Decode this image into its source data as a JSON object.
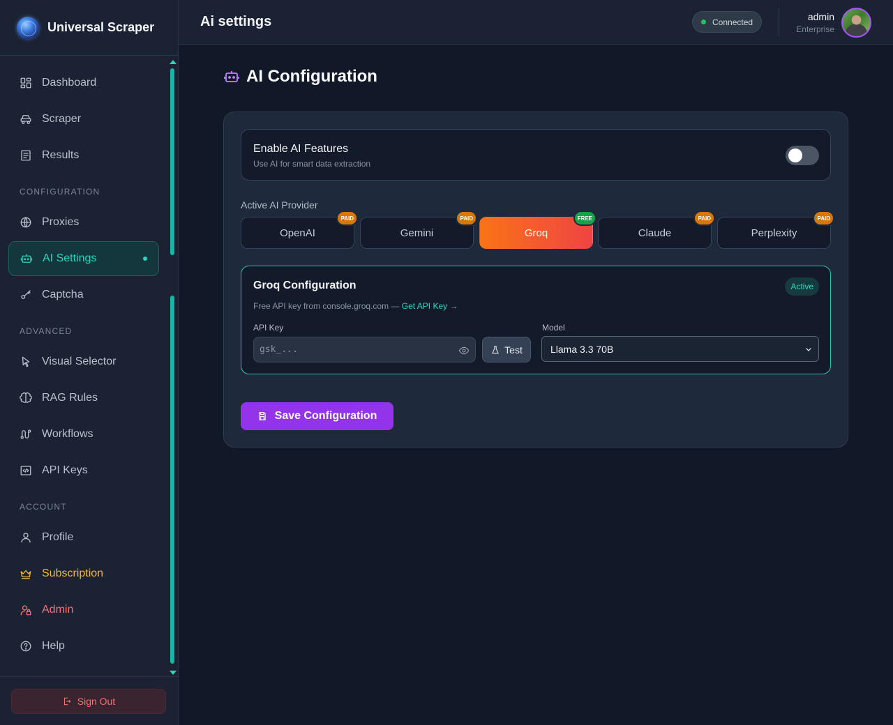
{
  "app": {
    "name": "Universal Scraper"
  },
  "sidebar": {
    "items": [
      {
        "label": "Dashboard",
        "icon": "dashboard-icon"
      },
      {
        "label": "Scraper",
        "icon": "scraper-icon"
      },
      {
        "label": "Results",
        "icon": "results-icon"
      }
    ],
    "section_configuration": "CONFIGURATION",
    "config_items": [
      {
        "label": "Proxies",
        "icon": "globe-icon"
      },
      {
        "label": "AI Settings",
        "icon": "robot-icon",
        "active": true
      },
      {
        "label": "Captcha",
        "icon": "key-icon"
      }
    ],
    "section_advanced": "ADVANCED",
    "advanced_items": [
      {
        "label": "Visual Selector",
        "icon": "cursor-icon"
      },
      {
        "label": "RAG Rules",
        "icon": "brain-icon"
      },
      {
        "label": "Workflows",
        "icon": "workflow-icon"
      },
      {
        "label": "API Keys",
        "icon": "code-icon"
      }
    ],
    "section_account": "ACCOUNT",
    "account_items": [
      {
        "label": "Profile",
        "icon": "user-icon"
      },
      {
        "label": "Subscription",
        "icon": "crown-icon",
        "color": "#f5b836"
      },
      {
        "label": "Admin",
        "icon": "user-lock-icon",
        "color": "#f87171"
      },
      {
        "label": "Help",
        "icon": "help-icon"
      }
    ],
    "sign_out": "Sign Out"
  },
  "header": {
    "title": "Ai settings",
    "status": "Connected",
    "user_name": "admin",
    "user_plan": "Enterprise"
  },
  "main": {
    "title": "AI Configuration",
    "enable": {
      "title": "Enable AI Features",
      "subtitle": "Use AI for smart data extraction",
      "enabled": false
    },
    "provider_label": "Active AI Provider",
    "providers": [
      {
        "name": "OpenAI",
        "badge": "PAID"
      },
      {
        "name": "Gemini",
        "badge": "PAID"
      },
      {
        "name": "Groq",
        "badge": "FREE",
        "selected": true
      },
      {
        "name": "Claude",
        "badge": "PAID"
      },
      {
        "name": "Perplexity",
        "badge": "PAID"
      }
    ],
    "config": {
      "title": "Groq Configuration",
      "status": "Active",
      "subtitle": "Free API key from console.groq.com —",
      "link": "Get API Key →",
      "api_key_label": "API Key",
      "api_key_placeholder": "gsk_...",
      "test_label": "Test",
      "model_label": "Model",
      "model_value": "Llama 3.3 70B"
    },
    "save_label": "Save Configuration"
  },
  "colors": {
    "accent": "#2dd4bf",
    "primary_button": "#9333ea",
    "selected_provider": "#f97316",
    "paid_badge": "#d97706",
    "free_badge": "#16a34a"
  }
}
